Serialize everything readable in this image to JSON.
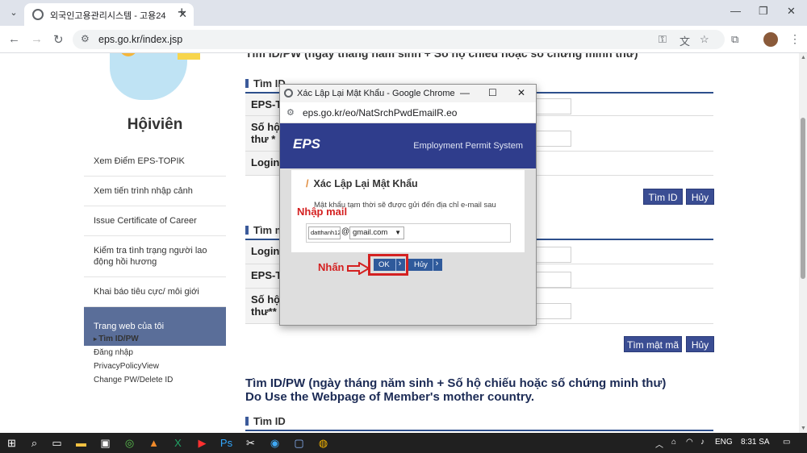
{
  "browser": {
    "tab_title": "외국인고용관리시스템 - 고용24",
    "url": "eps.go.kr/index.jsp"
  },
  "sidebar": {
    "title": "Hộiviên",
    "items": [
      {
        "label": "Xem Điểm EPS-TOPIK"
      },
      {
        "label": "Xem tiến trình nhập cảnh"
      },
      {
        "label": "Issue Certificate of Career"
      },
      {
        "label": "Kiểm tra tình trạng người lao động hồi hương"
      },
      {
        "label": "Khai báo tiêu cực/ môi giới"
      },
      {
        "label": "Trang web của tôi"
      }
    ],
    "sub_items": [
      {
        "label": "Tìm ID/PW"
      },
      {
        "label": "Đăng nhập"
      },
      {
        "label": "PrivacyPolicyView"
      },
      {
        "label": "Change PW/Delete ID"
      }
    ]
  },
  "main": {
    "top_cut_text": "Tìm ID/PW (ngày tháng năm sinh + Số hộ chiếu hoặc số chứng minh thư)",
    "section1": {
      "title": "Tìm ID",
      "rows": [
        "EPS-T",
        "Số hộ\nthư *",
        "Login"
      ],
      "search_button": "Tìm ID",
      "cancel_button": "Hủy"
    },
    "section2": {
      "title": "Tìm m",
      "rows": [
        "Login",
        "EPS-T",
        "Số hộ\nthư**"
      ],
      "search_button": "Tìm mật mã",
      "cancel_button": "Hủy"
    },
    "heading_line1": "Tìm ID/PW (ngày tháng năm sinh + Số hộ chiếu hoặc số chứng minh thư)",
    "heading_line2": "Do Use the Webpage of Member's mother country.",
    "section3_title": "Tìm ID"
  },
  "popup": {
    "window_title": "Xác Lập Lại Mật Khẩu - Google Chrome",
    "url": "eps.go.kr/eo/NatSrchPwdEmailR.eo",
    "logo": "EPS",
    "tagline": "Employment Permit System",
    "heading": "Xác Lập Lại Mật Khẩu",
    "description": "Mật khẩu tạm thời sẽ được gửi đến địa chỉ e-mail sau",
    "email_user": "datthanh12",
    "at": "@",
    "email_domain": "gmail.com",
    "ok_label": "OK",
    "cancel_label": "Hủy"
  },
  "annotations": {
    "mail_label": "Nhập mail",
    "click_label": "Nhấn",
    "highlight_color": "#d42121"
  },
  "taskbar": {
    "language": "ENG",
    "time": "8:31 SA"
  },
  "colors": {
    "sidebar_active": "#5a6e99",
    "button_blue": "#3a4d93",
    "eps_header": "#2f3d8c"
  }
}
